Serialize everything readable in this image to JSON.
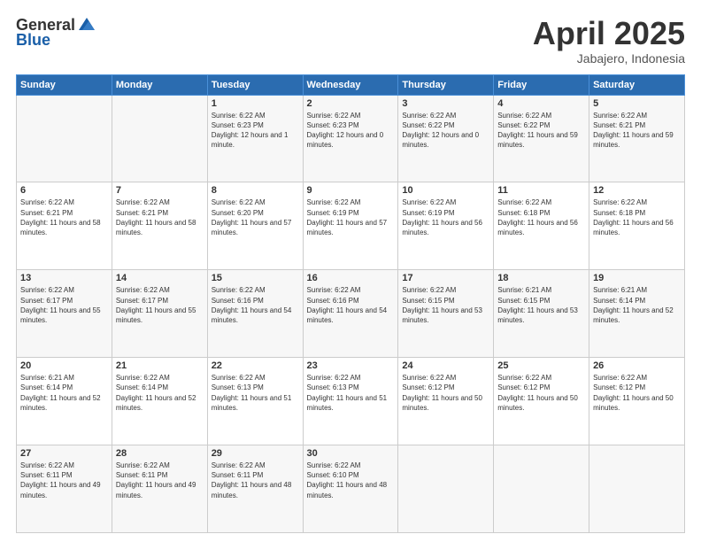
{
  "header": {
    "logo": {
      "general": "General",
      "blue": "Blue"
    },
    "title": "April 2025",
    "subtitle": "Jabajero, Indonesia"
  },
  "weekdays": [
    "Sunday",
    "Monday",
    "Tuesday",
    "Wednesday",
    "Thursday",
    "Friday",
    "Saturday"
  ],
  "weeks": [
    [
      {
        "day": "",
        "sunrise": "",
        "sunset": "",
        "daylight": ""
      },
      {
        "day": "",
        "sunrise": "",
        "sunset": "",
        "daylight": ""
      },
      {
        "day": "1",
        "sunrise": "Sunrise: 6:22 AM",
        "sunset": "Sunset: 6:23 PM",
        "daylight": "Daylight: 12 hours and 1 minute."
      },
      {
        "day": "2",
        "sunrise": "Sunrise: 6:22 AM",
        "sunset": "Sunset: 6:23 PM",
        "daylight": "Daylight: 12 hours and 0 minutes."
      },
      {
        "day": "3",
        "sunrise": "Sunrise: 6:22 AM",
        "sunset": "Sunset: 6:22 PM",
        "daylight": "Daylight: 12 hours and 0 minutes."
      },
      {
        "day": "4",
        "sunrise": "Sunrise: 6:22 AM",
        "sunset": "Sunset: 6:22 PM",
        "daylight": "Daylight: 11 hours and 59 minutes."
      },
      {
        "day": "5",
        "sunrise": "Sunrise: 6:22 AM",
        "sunset": "Sunset: 6:21 PM",
        "daylight": "Daylight: 11 hours and 59 minutes."
      }
    ],
    [
      {
        "day": "6",
        "sunrise": "Sunrise: 6:22 AM",
        "sunset": "Sunset: 6:21 PM",
        "daylight": "Daylight: 11 hours and 58 minutes."
      },
      {
        "day": "7",
        "sunrise": "Sunrise: 6:22 AM",
        "sunset": "Sunset: 6:21 PM",
        "daylight": "Daylight: 11 hours and 58 minutes."
      },
      {
        "day": "8",
        "sunrise": "Sunrise: 6:22 AM",
        "sunset": "Sunset: 6:20 PM",
        "daylight": "Daylight: 11 hours and 57 minutes."
      },
      {
        "day": "9",
        "sunrise": "Sunrise: 6:22 AM",
        "sunset": "Sunset: 6:19 PM",
        "daylight": "Daylight: 11 hours and 57 minutes."
      },
      {
        "day": "10",
        "sunrise": "Sunrise: 6:22 AM",
        "sunset": "Sunset: 6:19 PM",
        "daylight": "Daylight: 11 hours and 56 minutes."
      },
      {
        "day": "11",
        "sunrise": "Sunrise: 6:22 AM",
        "sunset": "Sunset: 6:18 PM",
        "daylight": "Daylight: 11 hours and 56 minutes."
      },
      {
        "day": "12",
        "sunrise": "Sunrise: 6:22 AM",
        "sunset": "Sunset: 6:18 PM",
        "daylight": "Daylight: 11 hours and 56 minutes."
      }
    ],
    [
      {
        "day": "13",
        "sunrise": "Sunrise: 6:22 AM",
        "sunset": "Sunset: 6:17 PM",
        "daylight": "Daylight: 11 hours and 55 minutes."
      },
      {
        "day": "14",
        "sunrise": "Sunrise: 6:22 AM",
        "sunset": "Sunset: 6:17 PM",
        "daylight": "Daylight: 11 hours and 55 minutes."
      },
      {
        "day": "15",
        "sunrise": "Sunrise: 6:22 AM",
        "sunset": "Sunset: 6:16 PM",
        "daylight": "Daylight: 11 hours and 54 minutes."
      },
      {
        "day": "16",
        "sunrise": "Sunrise: 6:22 AM",
        "sunset": "Sunset: 6:16 PM",
        "daylight": "Daylight: 11 hours and 54 minutes."
      },
      {
        "day": "17",
        "sunrise": "Sunrise: 6:22 AM",
        "sunset": "Sunset: 6:15 PM",
        "daylight": "Daylight: 11 hours and 53 minutes."
      },
      {
        "day": "18",
        "sunrise": "Sunrise: 6:21 AM",
        "sunset": "Sunset: 6:15 PM",
        "daylight": "Daylight: 11 hours and 53 minutes."
      },
      {
        "day": "19",
        "sunrise": "Sunrise: 6:21 AM",
        "sunset": "Sunset: 6:14 PM",
        "daylight": "Daylight: 11 hours and 52 minutes."
      }
    ],
    [
      {
        "day": "20",
        "sunrise": "Sunrise: 6:21 AM",
        "sunset": "Sunset: 6:14 PM",
        "daylight": "Daylight: 11 hours and 52 minutes."
      },
      {
        "day": "21",
        "sunrise": "Sunrise: 6:22 AM",
        "sunset": "Sunset: 6:14 PM",
        "daylight": "Daylight: 11 hours and 52 minutes."
      },
      {
        "day": "22",
        "sunrise": "Sunrise: 6:22 AM",
        "sunset": "Sunset: 6:13 PM",
        "daylight": "Daylight: 11 hours and 51 minutes."
      },
      {
        "day": "23",
        "sunrise": "Sunrise: 6:22 AM",
        "sunset": "Sunset: 6:13 PM",
        "daylight": "Daylight: 11 hours and 51 minutes."
      },
      {
        "day": "24",
        "sunrise": "Sunrise: 6:22 AM",
        "sunset": "Sunset: 6:12 PM",
        "daylight": "Daylight: 11 hours and 50 minutes."
      },
      {
        "day": "25",
        "sunrise": "Sunrise: 6:22 AM",
        "sunset": "Sunset: 6:12 PM",
        "daylight": "Daylight: 11 hours and 50 minutes."
      },
      {
        "day": "26",
        "sunrise": "Sunrise: 6:22 AM",
        "sunset": "Sunset: 6:12 PM",
        "daylight": "Daylight: 11 hours and 50 minutes."
      }
    ],
    [
      {
        "day": "27",
        "sunrise": "Sunrise: 6:22 AM",
        "sunset": "Sunset: 6:11 PM",
        "daylight": "Daylight: 11 hours and 49 minutes."
      },
      {
        "day": "28",
        "sunrise": "Sunrise: 6:22 AM",
        "sunset": "Sunset: 6:11 PM",
        "daylight": "Daylight: 11 hours and 49 minutes."
      },
      {
        "day": "29",
        "sunrise": "Sunrise: 6:22 AM",
        "sunset": "Sunset: 6:11 PM",
        "daylight": "Daylight: 11 hours and 48 minutes."
      },
      {
        "day": "30",
        "sunrise": "Sunrise: 6:22 AM",
        "sunset": "Sunset: 6:10 PM",
        "daylight": "Daylight: 11 hours and 48 minutes."
      },
      {
        "day": "",
        "sunrise": "",
        "sunset": "",
        "daylight": ""
      },
      {
        "day": "",
        "sunrise": "",
        "sunset": "",
        "daylight": ""
      },
      {
        "day": "",
        "sunrise": "",
        "sunset": "",
        "daylight": ""
      }
    ]
  ]
}
